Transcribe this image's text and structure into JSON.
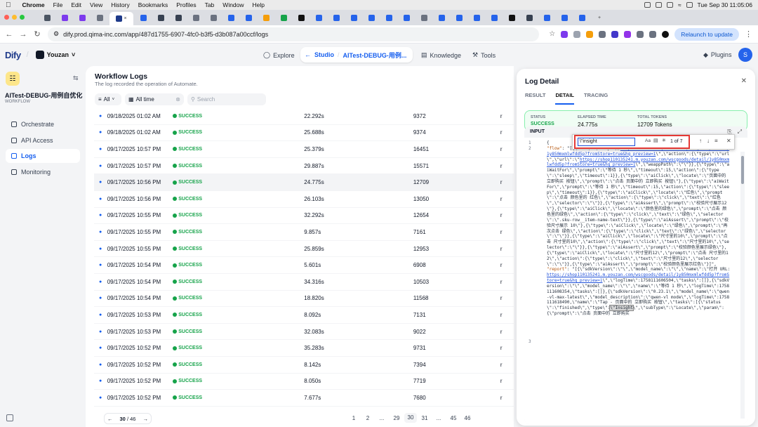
{
  "mac": {
    "menu": [
      "Chrome",
      "File",
      "Edit",
      "View",
      "History",
      "Bookmarks",
      "Profiles",
      "Tab",
      "Window",
      "Help"
    ],
    "datetime": "Tue Sep 30  11:05:06"
  },
  "browser": {
    "url": "dify.prod.qima-inc.com/app/487d1755-6907-4fc0-b3f5-d3b087a00ccf/logs",
    "relaunch": "Relaunch to update"
  },
  "appnav": {
    "logo": "Dify",
    "workspace": "Youzan",
    "explore": "Explore",
    "studio": "Studio",
    "app_breadcrumb": "AITest-DEBUG-用例...",
    "knowledge": "Knowledge",
    "tools": "Tools",
    "plugins": "Plugins",
    "avatar": "S"
  },
  "sidebar": {
    "app_name": "AITest-DEBUG-用例自优化",
    "app_type": "WORKFLOW",
    "items": [
      {
        "label": "Orchestrate"
      },
      {
        "label": "API Access"
      },
      {
        "label": "Logs"
      },
      {
        "label": "Monitoring"
      }
    ]
  },
  "main": {
    "title": "Workflow Logs",
    "subtitle": "The log recorded the operation of Automate.",
    "filter_status": "All",
    "filter_period": "All time",
    "search_placeholder": "Search",
    "rows": [
      {
        "time": "09/18/2025 01:02 AM",
        "status": "SUCCESS",
        "elapsed": "22.292s",
        "tokens": "9372",
        "trigger": "r"
      },
      {
        "time": "09/18/2025 01:02 AM",
        "status": "SUCCESS",
        "elapsed": "25.688s",
        "tokens": "9374",
        "trigger": "r"
      },
      {
        "time": "09/17/2025 10:57 PM",
        "status": "SUCCESS",
        "elapsed": "25.379s",
        "tokens": "16451",
        "trigger": "r"
      },
      {
        "time": "09/17/2025 10:57 PM",
        "status": "SUCCESS",
        "elapsed": "29.887s",
        "tokens": "15571",
        "trigger": "r"
      },
      {
        "time": "09/17/2025 10:56 PM",
        "status": "SUCCESS",
        "elapsed": "24.775s",
        "tokens": "12709",
        "trigger": "r"
      },
      {
        "time": "09/17/2025 10:56 PM",
        "status": "SUCCESS",
        "elapsed": "26.103s",
        "tokens": "13050",
        "trigger": "r"
      },
      {
        "time": "09/17/2025 10:55 PM",
        "status": "SUCCESS",
        "elapsed": "32.292s",
        "tokens": "12654",
        "trigger": "r"
      },
      {
        "time": "09/17/2025 10:55 PM",
        "status": "SUCCESS",
        "elapsed": "9.857s",
        "tokens": "7161",
        "trigger": "r"
      },
      {
        "time": "09/17/2025 10:55 PM",
        "status": "SUCCESS",
        "elapsed": "25.859s",
        "tokens": "12953",
        "trigger": "r"
      },
      {
        "time": "09/17/2025 10:54 PM",
        "status": "SUCCESS",
        "elapsed": "5.601s",
        "tokens": "6908",
        "trigger": "r"
      },
      {
        "time": "09/17/2025 10:54 PM",
        "status": "SUCCESS",
        "elapsed": "34.316s",
        "tokens": "10503",
        "trigger": "r"
      },
      {
        "time": "09/17/2025 10:54 PM",
        "status": "SUCCESS",
        "elapsed": "18.820s",
        "tokens": "11568",
        "trigger": "r"
      },
      {
        "time": "09/17/2025 10:53 PM",
        "status": "SUCCESS",
        "elapsed": "8.092s",
        "tokens": "7131",
        "trigger": "r"
      },
      {
        "time": "09/17/2025 10:53 PM",
        "status": "SUCCESS",
        "elapsed": "32.083s",
        "tokens": "9022",
        "trigger": "r"
      },
      {
        "time": "09/17/2025 10:52 PM",
        "status": "SUCCESS",
        "elapsed": "35.283s",
        "tokens": "9731",
        "trigger": "r"
      },
      {
        "time": "09/17/2025 10:52 PM",
        "status": "SUCCESS",
        "elapsed": "8.142s",
        "tokens": "7394",
        "trigger": "r"
      },
      {
        "time": "09/17/2025 10:52 PM",
        "status": "SUCCESS",
        "elapsed": "8.050s",
        "tokens": "7719",
        "trigger": "r"
      },
      {
        "time": "09/17/2025 10:52 PM",
        "status": "SUCCESS",
        "elapsed": "7.677s",
        "tokens": "7680",
        "trigger": "r"
      }
    ],
    "pager": {
      "current": "30",
      "total": "46",
      "pages": [
        "1",
        "2",
        "...",
        "29",
        "30",
        "31",
        "...",
        "45",
        "46"
      ]
    }
  },
  "panel": {
    "title": "Log Detail",
    "tabs": [
      "RESULT",
      "DETAIL",
      "TRACING"
    ],
    "status_label": "STATUS",
    "status_value": "SUCCESS",
    "elapsed_label": "ELAPSED TIME",
    "elapsed_value": "24.775s",
    "tokens_label": "TOTAL TOKENS",
    "tokens_value": "12709 Tokens",
    "input_label": "INPUT",
    "find": {
      "query": "\\\"insight",
      "count": "1 of 7",
      "aa": "Aa"
    },
    "code": {
      "l1": "{",
      "l2_key": "\"flow\"",
      "l2_val": ": \"[{\\\"url\\\":\\\"https://",
      "l2_url": "shop110135241.m.youzan.com/wscgoods/detail/1y850mxmlwfdd5p?fromStore=true&hq_preview=1",
      "l2_rest": "\\\",\\\"action\\\":{\\\"type\\\":\\\"url\\\",\\\"url\\\":\\\"",
      "l2_url2": "https://shop110135241.m.youzan.com/wscgoods/detail/1y850mxmlwfdd5p?fromStore=true&hq_preview=1",
      "l2_rest2": "\\\",\\\"weappPath\\\":\\\"\\\"}},{\\\"type\\\":\\\"aiWaitFor\\\",\\\"prompt\\\":\\\"等待 1 秒\\\",\\\"timeout\\\":15,\\\"action\\\":{\\\"type\\\":\\\"sleep\\\",\\\"timeout\\\":1}},{\\\"type\\\":\\\"aiClick\\\",\\\"locate\\\":\\\"页面中的 立即购买 按钮\\\",\\\"prompt\\\":\\\"点击 页面中的 立即购买 按钮\\\"},{\\\"type\\\":\\\"aiWaitFor\\\",\\\"prompt\\\":\\\"等待 1 秒\\\",\\\"timeout\\\":15,\\\"action\\\":{\\\"type\\\":\\\"sleep\\\",\\\"timeout\\\":1}},{\\\"type\\\":\\\"aiClick\\\",\\\"locate\\\":\\\"红色\\\",\\\"prompt\\\":\\\"点击 颜色里的 红色\\\",\\\"action\\\":{\\\"type\\\":\\\"click\\\",\\\"text\\\":\\\"红色\\\",\\\"selector\\\":\\\"\\\"}},{\\\"type\\\":\\\"aiAssert\\\",\\\"prompt\\\":\\\"校验尺寸展示12\\\"},{\\\"type\\\":\\\"aiClick\\\",\\\"locate\\\":\\\"颜色里的绿色\\\",\\\"prompt\\\":\\\"点击 颜色里的绿色\\\",\\\"action\\\":{\\\"type\\\":\\\"click\\\",\\\"text\\\":\\\"绿色\\\",\\\"selector\\\":\\\".sku-row__item-name-text\\\"}},{\\\"type\\\":\\\"aiAssert\\\",\\\"prompt\\\":\\\"校验尺寸展示 10\\\"},{\\\"type\\\":\\\"aiClick\\\",\\\"locate\\\":\\\"绿色\\\",\\\"prompt\\\":\\\"再次点击 绿色\\\",\\\"action\\\":{\\\"type\\\":\\\"click\\\",\\\"text\\\":\\\"绿色\\\",\\\"selector\\\":\\\"\\\"}},{\\\"type\\\":\\\"aiClick\\\",\\\"locate\\\":\\\"尺寸里的10\\\",\\\"prompt\\\":\\\"点击 尺寸里的10\\\",\\\"action\\\":{\\\"type\\\":\\\"click\\\",\\\"text\\\":\\\"尺寸里的10\\\",\\\"selector\\\":\\\"\\\"}},{\\\"type\\\":\\\"aiAssert\\\",\\\"prompt\\\":\\\"校验颜色里展示绿色\\\"},{\\\"type\\\":\\\"aiClick\\\",\\\"locate\\\":\\\"尺寸里的12\\\",\\\"prompt\\\":\\\"点击 尺寸里的12\\\",\\\"action\\\":{\\\"type\\\":\\\"click\\\",\\\"text\\\":\\\"尺寸里的12\\\",\\\"selector\\\":\\\"\\\"}},{\\\"type\\\":\\\"aiAssert\\\",\\\"prompt\\\":\\\"校验颜色里展示红色\\\"}]\",",
      "l3_key": "\"report\"",
      "l3_val": ": \"[{\\\"sdkVersion\\\":\\\"\\\",\\\"model_name\\\":\\\"\\\",\\\"name\\\":\\\"打开 URL: ",
      "l3_url": "https://shop110135241.m.youzan.com/wscgoods/detail/1y850mxmlwfdd5p?fromStore=true&hq_preview=1",
      "l3_rest": "\\\",\\\"logTime\\\":1758111606504,\\\"tasks\\\":[]},{\\\"sdkVersion\\\":\\\"\\\",\\\"model_name\\\":\\\"\\\",\\\"name\\\":\\\"等待 1 秒\\\",\\\"logTime\\\":1758111608354,\\\"tasks\\\":[]},{\\\"sdkVersion\\\":\\\"0.23.1\\\",\\\"model_name\\\":\\\"qwen-vl-max-latest\\\",\\\"model_description\\\":\\\"qwen-vl mode\\\",\\\"logTime\\\":1758111618490,\\\"name\\\":\\\"Tap - 页面中的 立即购买 按钮\\\",\\\"tasks\\\":[{\\\"status\\\":\\\"finished\\\",\\\"type\\\":",
      "l3_hl": "\\\"Insight",
      "l3_tail": "\\\",\\\"subType\\\":\\\"Locate\\\",\\\"param\\\":{\\\"prompt\\\":\\\"点击 页面中的 立即购买"
    }
  }
}
